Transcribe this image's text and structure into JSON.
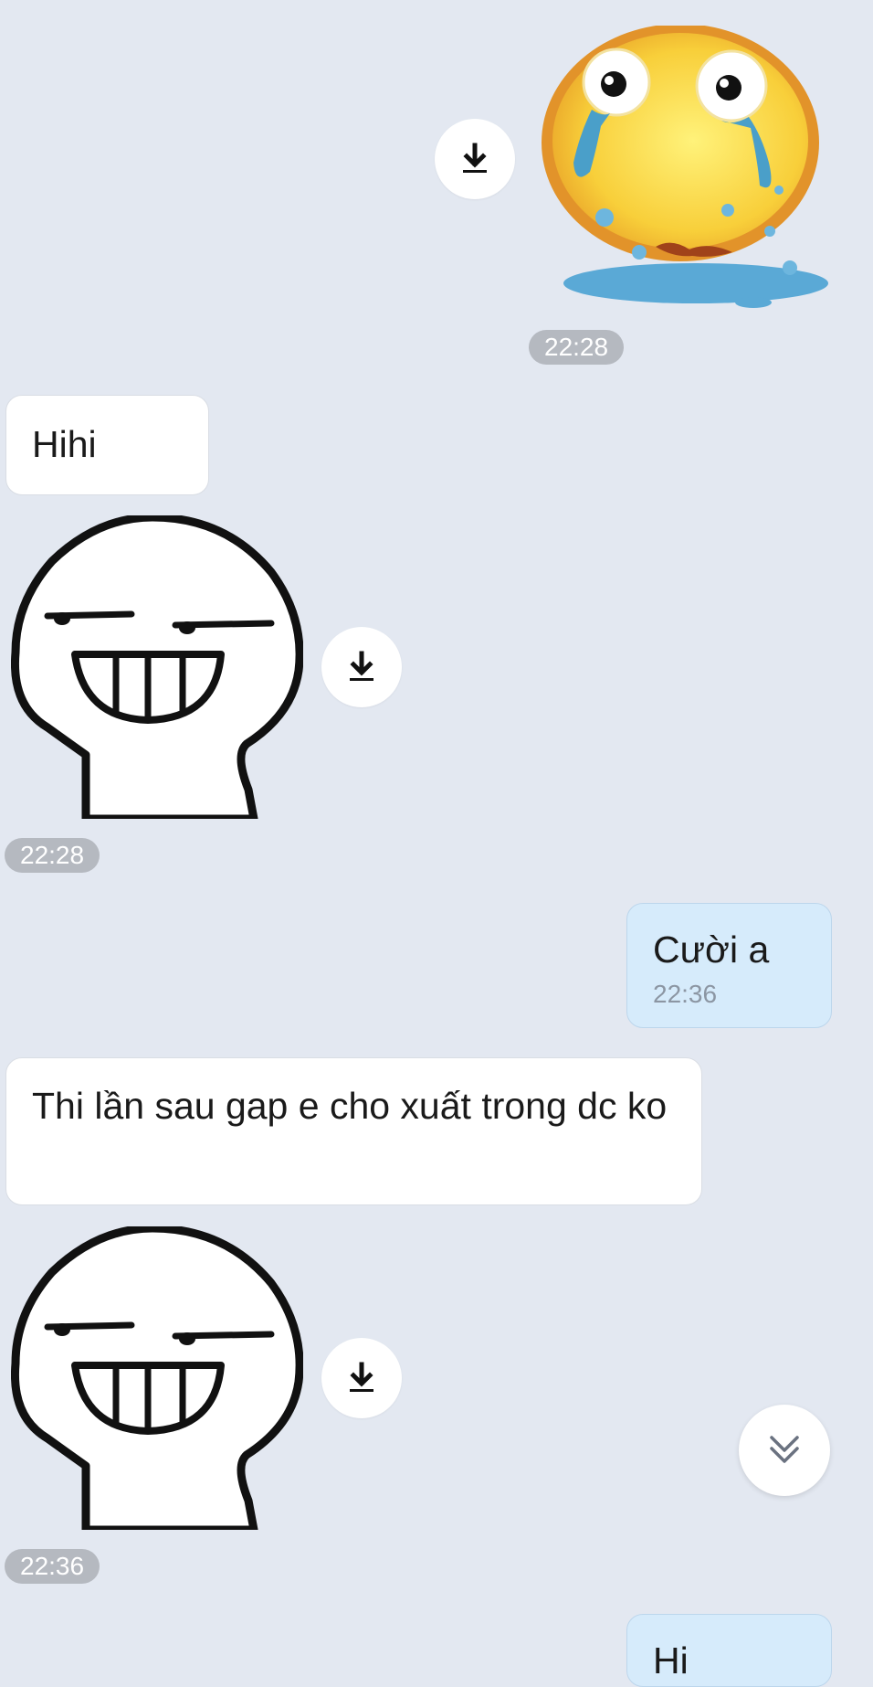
{
  "messages": {
    "m1": {
      "sticker": "crying-emoji-sticker",
      "time": "22:28"
    },
    "m2": {
      "text": "Hihi"
    },
    "m3": {
      "sticker": "grinning-stickman-sticker",
      "time": "22:28"
    },
    "m4": {
      "text": "Cười a",
      "time": "22:36"
    },
    "m5": {
      "text": "Thi lần sau gap e cho xuất trong dc ko"
    },
    "m6": {
      "sticker": "grinning-stickman-sticker",
      "time": "22:36"
    },
    "m7": {
      "text": "Hi"
    }
  },
  "icons": {
    "download": "download-icon",
    "scroll_down": "double-chevron-down-icon"
  },
  "colors": {
    "background": "#e3e8f1",
    "incoming_bubble": "#ffffff",
    "outgoing_bubble": "#d6ebfb",
    "time_pill": "#b5b9c0"
  }
}
